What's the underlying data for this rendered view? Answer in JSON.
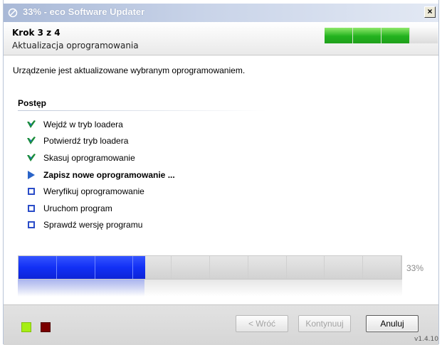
{
  "window": {
    "title": "33% - eco Software Updater",
    "close_label": "×"
  },
  "header": {
    "step": "Krok 3 z 4",
    "subtitle": "Aktualizacja oprogramowania",
    "progress_segments_done": 3,
    "progress_segments_total": 4
  },
  "description": "Urządzenie jest aktualizowane wybranym oprogramowaniem.",
  "progress_section": {
    "title": "Postęp",
    "steps": [
      {
        "label": "Wejdź w tryb loadera",
        "status": "done",
        "icon": "check-icon"
      },
      {
        "label": "Potwierdź tryb loadera",
        "status": "done",
        "icon": "check-icon"
      },
      {
        "label": "Skasuj oprogramowanie",
        "status": "done",
        "icon": "check-icon"
      },
      {
        "label": "Zapisz nowe oprogramowanie ...",
        "status": "current",
        "icon": "arrow-right-icon"
      },
      {
        "label": "Weryfikuj oprogramowanie",
        "status": "pending",
        "icon": "square-icon"
      },
      {
        "label": "Uruchom program",
        "status": "pending",
        "icon": "square-icon"
      },
      {
        "label": "Sprawdź wersję programu",
        "status": "pending",
        "icon": "square-icon"
      }
    ]
  },
  "main_progress": {
    "percent_label": "33%",
    "fraction": 0.33,
    "segments": 10
  },
  "footer": {
    "back_label": "< Wróć",
    "next_label": "Kontynuuj",
    "cancel_label": "Anuluj",
    "version": "v1.4.10",
    "status_colors": [
      "#a6ee15",
      "#7a0000"
    ]
  },
  "colors": {
    "accent_blue": "#1230f5",
    "header_green": "#22b21e"
  }
}
